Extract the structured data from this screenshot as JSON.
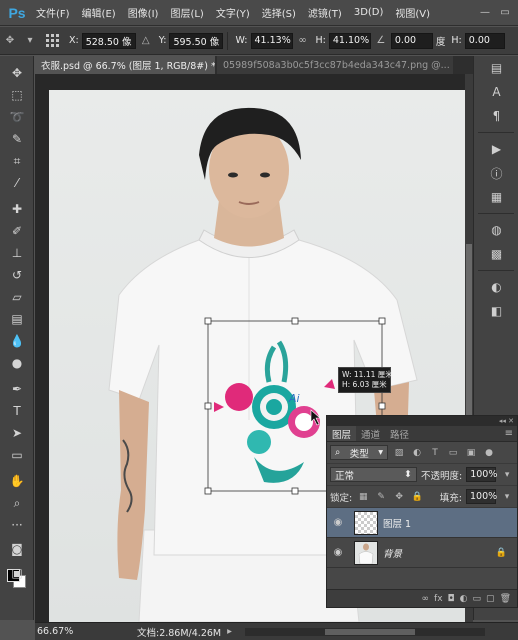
{
  "app": {
    "logo": "Ps"
  },
  "menu": [
    {
      "label": "文件(F)"
    },
    {
      "label": "编辑(E)"
    },
    {
      "label": "图像(I)"
    },
    {
      "label": "图层(L)"
    },
    {
      "label": "文字(Y)"
    },
    {
      "label": "选择(S)"
    },
    {
      "label": "滤镜(T)"
    },
    {
      "label": "3D(D)"
    },
    {
      "label": "视图(V)"
    }
  ],
  "options": {
    "x_label": "X:",
    "x_value": "528.50 像",
    "y_label": "Y:",
    "y_value": "595.50 像",
    "w_label": "W:",
    "w_value": "41.13%",
    "h_label": "H:",
    "h_value": "41.10%",
    "angle_value": "0.00",
    "angle_unit": "度",
    "hskew_label": "H:",
    "hskew_value": "0.00"
  },
  "tabs": [
    {
      "label": "衣服.psd @ 66.7% (图层 1, RGB/8#) *",
      "close": "×"
    },
    {
      "label": "05989f508a3b0c5f3cc87b4eda343c47.png @..."
    }
  ],
  "info_tooltip": {
    "line1": "W: 11.11 厘米",
    "line2": "H: 6.03 厘米"
  },
  "layers_panel": {
    "tabs": [
      "图层",
      "通道",
      "路径"
    ],
    "filter_label": "类型",
    "blend_mode": "正常",
    "opacity_label": "不透明度:",
    "opacity_value": "100%",
    "lock_label": "锁定:",
    "fill_label": "填充:",
    "fill_value": "100%",
    "layers": [
      {
        "name": "图层 1",
        "selected": true
      },
      {
        "name": "背景",
        "selected": false
      }
    ]
  },
  "status": {
    "zoom": "66.67%",
    "doc": "文档:2.86M/4.26M"
  },
  "colors": {
    "accent": "#3fa7e0",
    "selection": "#5d6e83"
  }
}
